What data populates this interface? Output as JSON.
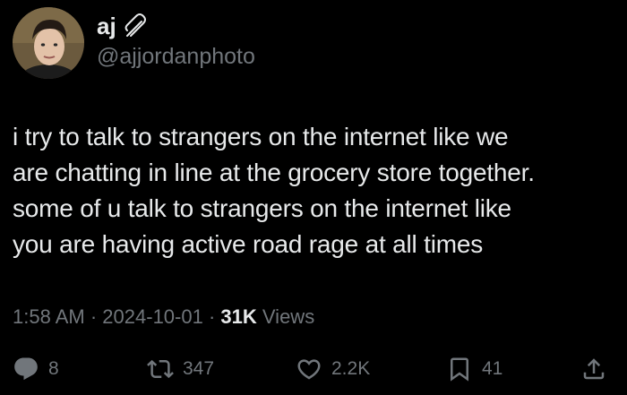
{
  "author": {
    "display_name": "aj",
    "handle": "@ajjordanphoto"
  },
  "tweet": {
    "text": "i try to talk to strangers on the internet like we\nare chatting in line at the grocery store together.\nsome of u talk to strangers on the internet like\nyou are having active road rage at all times"
  },
  "meta": {
    "time": "1:58 AM",
    "separator": "·",
    "date": "2024-10-01",
    "views_count": "31K",
    "views_label": "Views"
  },
  "actions": {
    "replies": "8",
    "reposts": "347",
    "likes": "2.2K",
    "bookmarks": "41"
  },
  "icons": {
    "pin": "safety-pin-icon",
    "reply": "speech-bubble-icon",
    "repost": "repost-arrows-icon",
    "like": "heart-icon",
    "bookmark": "bookmark-icon",
    "share": "share-icon"
  },
  "colors": {
    "background": "#000000",
    "primary_text": "#e7e9ea",
    "secondary_text": "#71767b"
  }
}
